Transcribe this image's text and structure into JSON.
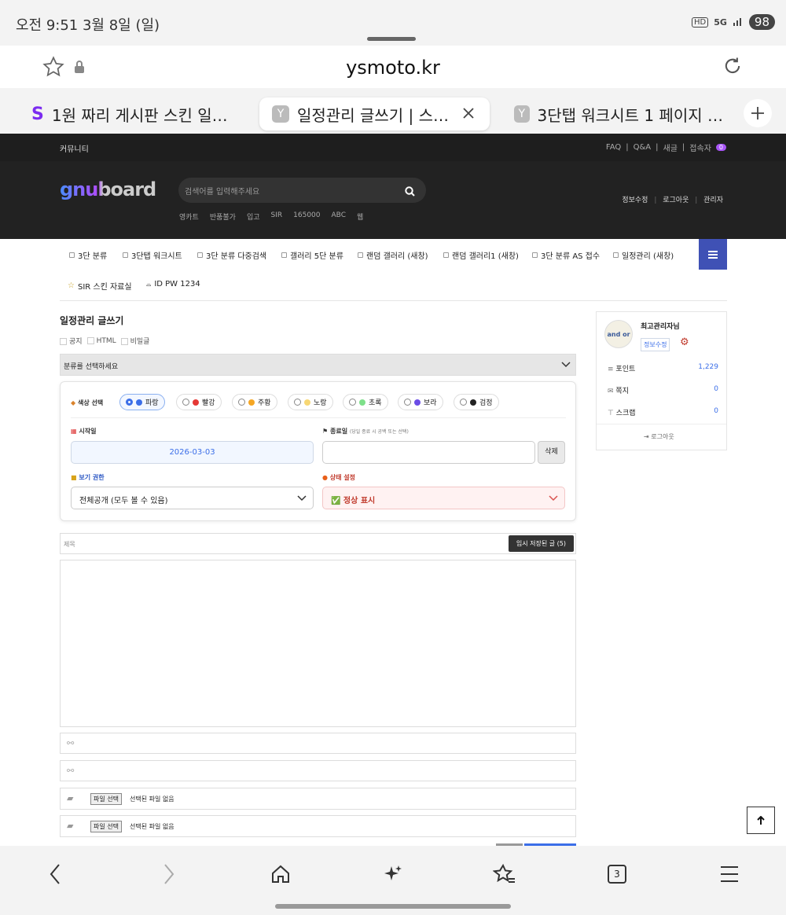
{
  "status": {
    "time": "오전 9:51  3월 8일 (일)",
    "hd": "HD",
    "net": "5G",
    "battery": "98"
  },
  "browser": {
    "url": "ysmoto.kr",
    "tabs": [
      {
        "label": "1원 짜리 게시판 스킨 일…",
        "favicon": "S"
      },
      {
        "label": "일정관리 글쓰기 | 스…",
        "favicon": "Y"
      },
      {
        "label": "3단탭 워크시트 1 페이지 …",
        "favicon": "Y"
      }
    ],
    "tab_count": "3"
  },
  "site": {
    "community": "커뮤니티",
    "top_links": [
      "FAQ",
      "Q&A",
      "새글",
      "접속자"
    ],
    "visitors": "0",
    "logo": "gnuboard",
    "search_placeholder": "검색어를 입력해주세요",
    "popular": [
      "영카트",
      "반품불가",
      "입고",
      "SIR",
      "165000",
      "ABC",
      "웹"
    ],
    "header_links": [
      "정보수정",
      "로그아웃",
      "관리자"
    ]
  },
  "menu": {
    "items": [
      "3단 분류",
      "3단탭 워크시트",
      "3단 분류 다중검색",
      "갤러리 5단 분류",
      "랜덤 갤러리 (새창)",
      "랜덤 갤러리1 (새창)",
      "3단 분류 AS 접수",
      "일정관리 (새창)"
    ],
    "row2": [
      "SIR 스킨 자료실",
      "ID PW 1234"
    ]
  },
  "form": {
    "title": "일정관리 글쓰기",
    "options": [
      "공지",
      "HTML",
      "비밀글"
    ],
    "category_placeholder": "분류를 선택하세요",
    "color_label": "색상 선택",
    "colors": [
      {
        "name": "파랑",
        "hex": "#3b6ee8",
        "selected": true
      },
      {
        "name": "빨강",
        "hex": "#e53935",
        "selected": false
      },
      {
        "name": "주황",
        "hex": "#f5a623",
        "selected": false
      },
      {
        "name": "노랑",
        "hex": "#f7d774",
        "selected": false
      },
      {
        "name": "초록",
        "hex": "#7ee08a",
        "selected": false
      },
      {
        "name": "보라",
        "hex": "#6b4de6",
        "selected": false
      },
      {
        "name": "검정",
        "hex": "#222222",
        "selected": false
      }
    ],
    "start_label": "시작일",
    "start_value": "2026-03-03",
    "end_label": "종료일",
    "end_hint": "(당일 종료 시 공백 또는 선택)",
    "delete_label": "삭제",
    "view_label": "보기 권한",
    "view_value": "전체공개 (모두 볼 수 있음)",
    "status_label": "상태 설정",
    "status_value": "✅ 정상 표시",
    "subject_placeholder": "제목",
    "draft_button": "임시 저장된 글 (5)",
    "file_button": "파일 선택",
    "file_none": "선택된 파일 없음"
  },
  "sidebar": {
    "avatar": "and or",
    "name": "최고관리자님",
    "edit": "정보수정",
    "rows": [
      {
        "label": "포인트",
        "value": "1,229"
      },
      {
        "label": "쪽지",
        "value": "0"
      },
      {
        "label": "스크랩",
        "value": "0"
      }
    ],
    "logout": "로그아웃"
  }
}
